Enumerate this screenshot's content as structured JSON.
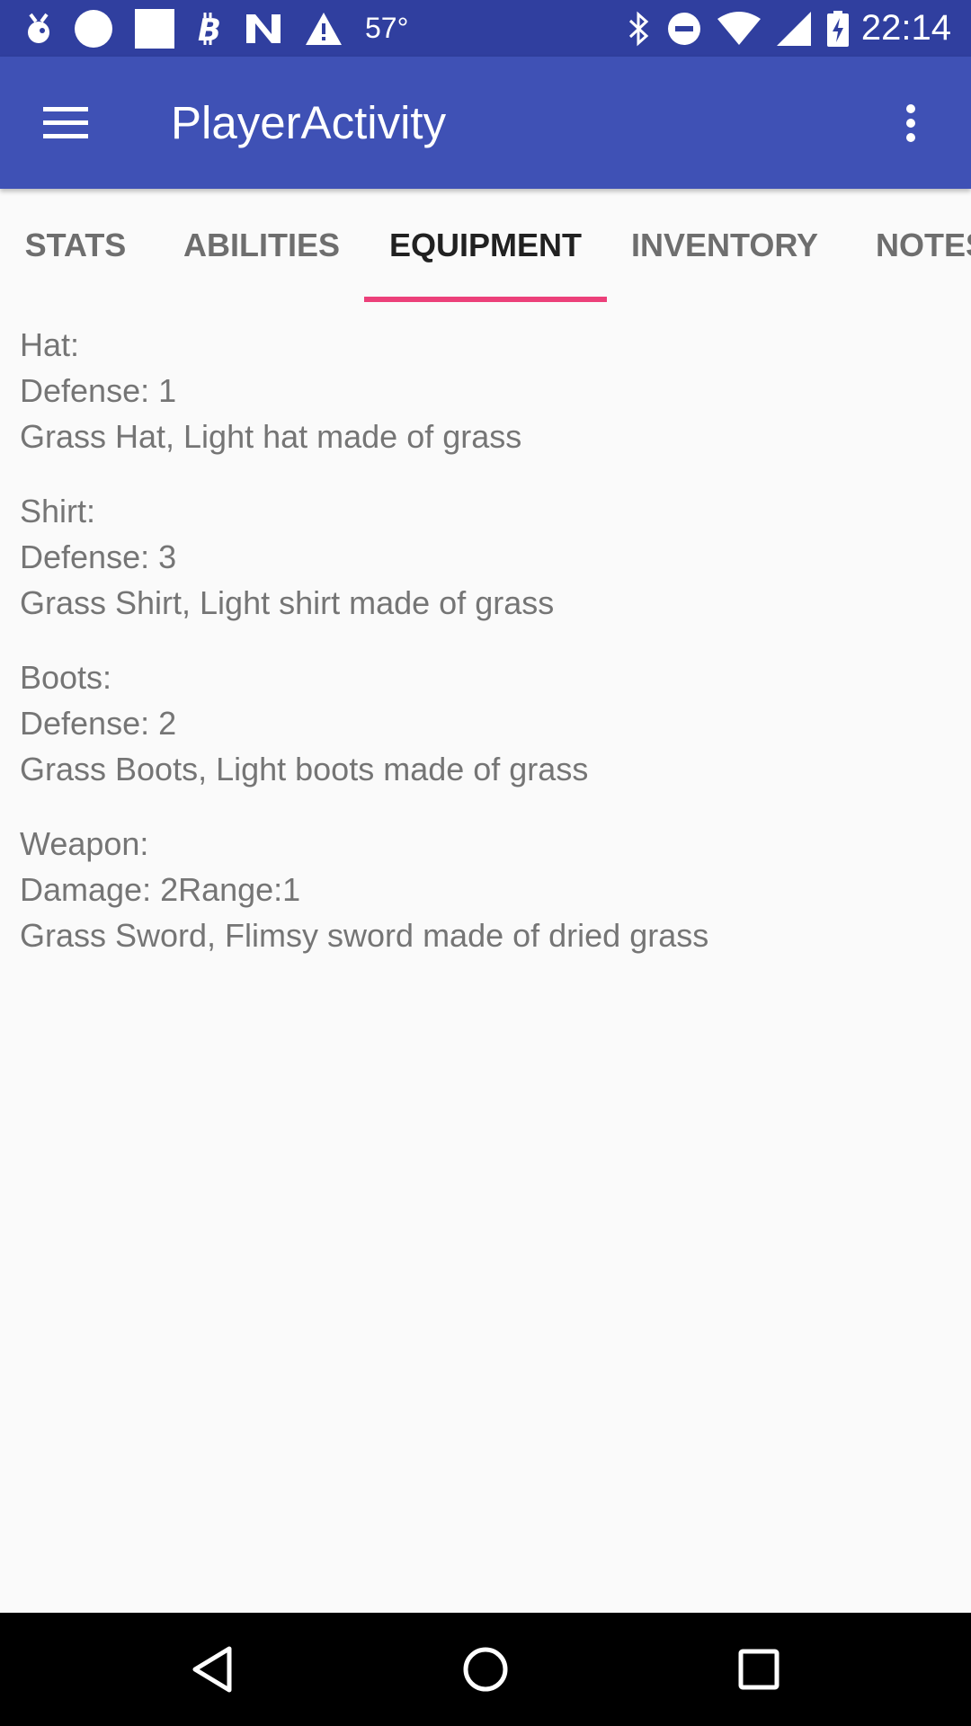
{
  "status_bar": {
    "temperature": "57°",
    "time": "22:14",
    "left_icons": [
      "pokeball-notification-icon",
      "circle-notification-icon",
      "square-notification-icon",
      "bitcoin-icon",
      "n-logo-icon",
      "warning-icon"
    ],
    "right_icons": [
      "bluetooth-icon",
      "do-not-disturb-icon",
      "wifi-icon",
      "signal-icon",
      "battery-charging-icon"
    ]
  },
  "app_bar": {
    "title": "PlayerActivity",
    "color": "#3f51b5",
    "status_color": "#303f9f"
  },
  "tabs": [
    {
      "label": "STATS",
      "active": false
    },
    {
      "label": "ABILITIES",
      "active": false
    },
    {
      "label": "EQUIPMENT",
      "active": true
    },
    {
      "label": "INVENTORY",
      "active": false
    },
    {
      "label": "NOTES",
      "active": false
    }
  ],
  "indicator_color": "#ec407a",
  "equipment": [
    {
      "slot": "Hat:",
      "stat": "Defense: 1",
      "description": "Grass Hat, Light hat made of grass"
    },
    {
      "slot": "Shirt:",
      "stat": "Defense: 3",
      "description": "Grass Shirt, Light shirt made of grass"
    },
    {
      "slot": "Boots:",
      "stat": "Defense: 2",
      "description": "Grass Boots, Light boots made of grass"
    },
    {
      "slot": "Weapon:",
      "stat": "Damage: 2Range:1",
      "description": "Grass Sword, Flimsy sword made of dried grass"
    }
  ],
  "nav_bar": {
    "buttons": [
      "back-icon",
      "home-icon",
      "recents-icon"
    ]
  }
}
